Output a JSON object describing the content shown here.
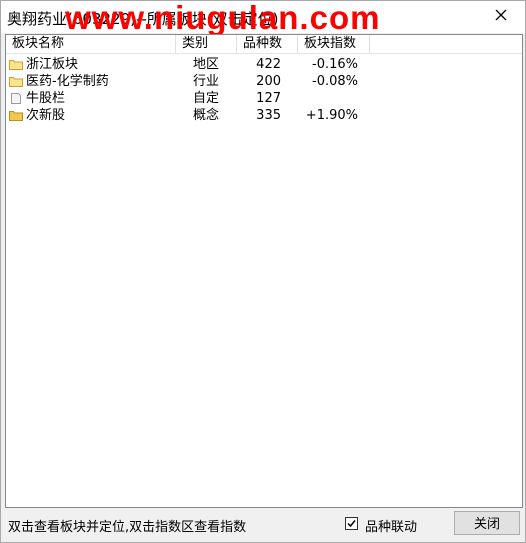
{
  "window": {
    "title": "奥翔药业(603229)--所属板块(双击定位)",
    "watermark": "www.niugulan.com"
  },
  "table": {
    "columns": [
      "板块名称",
      "类别",
      "品种数",
      "板块指数"
    ],
    "rows": [
      {
        "name": "浙江板块",
        "category": "地区",
        "count": "422",
        "index": "-0.16%",
        "icon": "folder-icon"
      },
      {
        "name": "医药-化学制药",
        "category": "行业",
        "count": "200",
        "index": "-0.08%",
        "icon": "folder-icon"
      },
      {
        "name": "牛股栏",
        "category": "自定",
        "count": "127",
        "index": "",
        "icon": "document-icon"
      },
      {
        "name": "次新股",
        "category": "概念",
        "count": "335",
        "index": "+1.90%",
        "icon": "folder-icon"
      }
    ]
  },
  "footer": {
    "hint": "双击查看板块并定位,双击指数区查看指数",
    "checkbox_label": "品种联动",
    "checkbox_checked": true,
    "close_label": "关闭"
  }
}
